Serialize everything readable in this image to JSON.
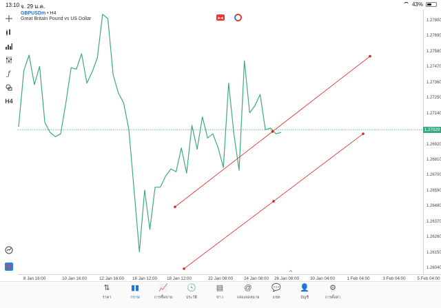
{
  "status": {
    "time": "13:10",
    "date": "จ. 29 ม.ค.",
    "battery": "43%",
    "battery_level": 0.43
  },
  "chart_header": {
    "symbol": "GBPUSDm",
    "timeframe": "H4",
    "description": "Great Britain Pound vs US Dollar",
    "sep": " • "
  },
  "toolbar": {
    "timeframe_label": "H4"
  },
  "price_axis": {
    "labels": [
      "1.27800",
      "1.27690",
      "1.27580",
      "1.27470",
      "1.27360",
      "1.27250",
      "1.27140",
      "1.27029",
      "1.26920",
      "1.26810",
      "1.26700",
      "1.26590",
      "1.26480",
      "1.26370",
      "1.26260",
      "1.26150",
      "1.26040"
    ],
    "current_price": "1.27029"
  },
  "time_axis": {
    "labels": [
      "8 Jan 16:00",
      "10 Jan 16:00",
      "12 Jan 16:00",
      "16 Jan 12:00",
      "18 Jan 12:00",
      "22 Jan 08:00",
      "24 Jan 08:00",
      "26 Jan 08:00",
      "30 Jan 04:00",
      "1 Feb 04:00",
      "3 Feb 04:00",
      "5 Feb 04:00"
    ]
  },
  "chart_data": {
    "type": "line",
    "symbol": "GBPUSDm",
    "timeframe": "H4",
    "ylim": [
      1.2595,
      1.279
    ],
    "series": [
      {
        "values": [
          1.2705,
          1.2745,
          1.2756,
          1.2735,
          1.2748,
          1.2708,
          1.2701,
          1.2698,
          1.27,
          1.2722,
          1.2747,
          1.2746,
          1.2757,
          1.2736,
          1.2744,
          1.2754,
          1.2785,
          1.2782,
          1.2742,
          1.2729,
          1.2722,
          1.2703,
          1.266,
          1.2616,
          1.266,
          1.2632,
          1.2662,
          1.2662,
          1.267,
          1.2675,
          1.2673,
          1.269,
          1.2672,
          1.2706,
          1.2689,
          1.2712,
          1.2697,
          1.27,
          1.269,
          1.2676,
          1.2736,
          1.27,
          1.2674,
          1.2752,
          1.2715,
          1.272,
          1.2728,
          1.2703,
          1.2704,
          1.27,
          1.2701
        ]
      }
    ],
    "channel_lines": [
      {
        "color": "#e53935",
        "start": {
          "date": "18 Jan 12:00",
          "price": 1.2648
        },
        "end": {
          "date": "4 Feb 04:00",
          "price": 1.27552
        }
      },
      {
        "color": "#e53935",
        "start": {
          "date": "19 Jan 00:00",
          "price": 1.2604
        },
        "end": {
          "date": "3 Feb 04:00",
          "price": 1.27
        }
      }
    ],
    "line_color": "#3aaa7e",
    "current_price_line": 1.27029
  },
  "bottom_nav": {
    "items": [
      {
        "label": "ราคา",
        "icon": "quotes-icon",
        "glyph": "⇅"
      },
      {
        "label": "กราฟ",
        "icon": "chart-icon",
        "glyph": "▮▮",
        "active": true
      },
      {
        "label": "การซื้อขาย",
        "icon": "trade-icon",
        "glyph": "📈"
      },
      {
        "label": "ประวัติ",
        "icon": "history-icon",
        "glyph": "🕓"
      },
      {
        "label": "ข่าว",
        "icon": "news-icon",
        "glyph": "▤"
      },
      {
        "label": "กล่องจดหมาย",
        "icon": "mailbox-icon",
        "glyph": "@"
      },
      {
        "label": "แชท",
        "icon": "chat-icon",
        "glyph": "💬"
      },
      {
        "label": "บัญชี",
        "icon": "account-icon",
        "glyph": "👤"
      },
      {
        "label": "การตั้งค่า",
        "icon": "settings-icon",
        "glyph": "⚙"
      }
    ]
  }
}
